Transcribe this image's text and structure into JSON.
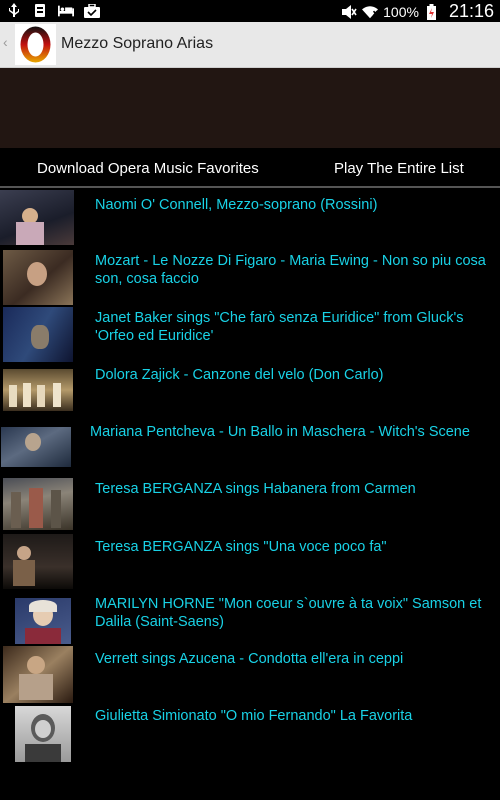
{
  "status_bar": {
    "icons": [
      "usb-icon",
      "download-icon",
      "bed-icon",
      "briefcase-icon",
      "mute-icon",
      "wifi-icon",
      "battery-icon"
    ],
    "battery": "100%",
    "time": "21:16"
  },
  "action_bar": {
    "title": "Mezzo Soprano Arias",
    "back_icon": "chevron-left-icon",
    "logo_icon": "opera-o-logo"
  },
  "toolbar": {
    "download_label": "Download Opera Music Favorites",
    "play_label": "Play The Entire List"
  },
  "colors": {
    "link": "#19d2e6",
    "banner": "#221612",
    "action_bar": "#e8e8e8"
  },
  "videos": [
    {
      "title": "Naomi O' Connell, Mezzo-soprano (Rossini)"
    },
    {
      "title": "Mozart - Le Nozze Di Figaro - Maria Ewing - Non so piu cosa son, cosa faccio"
    },
    {
      "title": "Janet Baker sings \"Che farò senza Euridice\" from Gluck's 'Orfeo ed Euridice'"
    },
    {
      "title": "Dolora Zajick - Canzone del velo (Don Carlo)"
    },
    {
      "title": "Mariana Pentcheva - Un Ballo in Maschera - Witch's Scene"
    },
    {
      "title": "Teresa BERGANZA sings Habanera from Carmen"
    },
    {
      "title": "Teresa BERGANZA sings \"Una voce poco fa\""
    },
    {
      "title": "MARILYN HORNE \"Mon coeur s`ouvre à ta voix\" Samson et Dalila (Saint-Saens)"
    },
    {
      "title": "Verrett sings Azucena - Condotta ell'era in ceppi"
    },
    {
      "title": "Giulietta Simionato \"O mio Fernando\" La Favorita"
    }
  ]
}
